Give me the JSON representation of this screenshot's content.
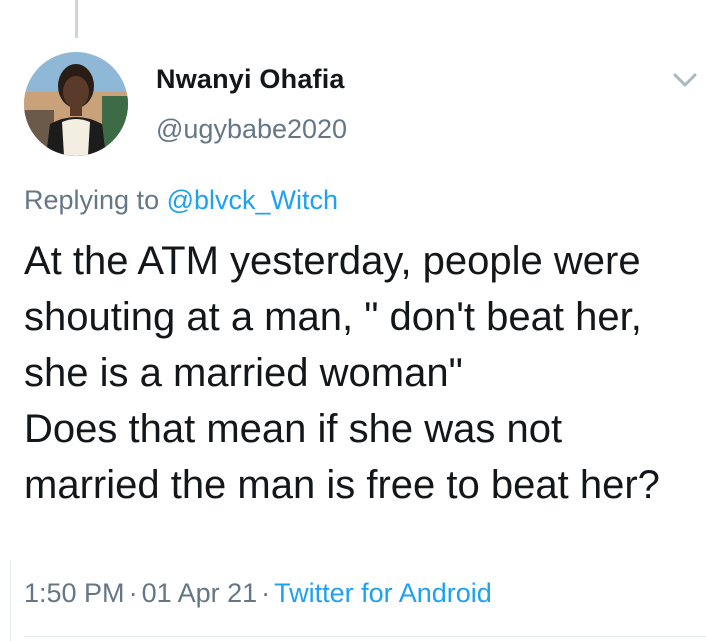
{
  "tweet": {
    "display_name": "Nwanyi Ohafia",
    "handle": "@ugybabe2020",
    "replying_prefix": "Replying to",
    "replying_to": "@blvck_Witch",
    "text": "At the ATM yesterday, people were shouting at a man, \" don't beat her, she is a married woman\"\nDoes that mean if she was not married the man is free to beat her?",
    "time": "1:50 PM",
    "date": "01 Apr 21",
    "separator": "·",
    "source": "Twitter for Android"
  },
  "icons": {
    "menu_caret": "chevron-down-icon"
  },
  "colors": {
    "link": "#1da1f2",
    "secondary_text": "#657786",
    "primary_text": "#14171a",
    "divider": "#e1e8ed"
  }
}
